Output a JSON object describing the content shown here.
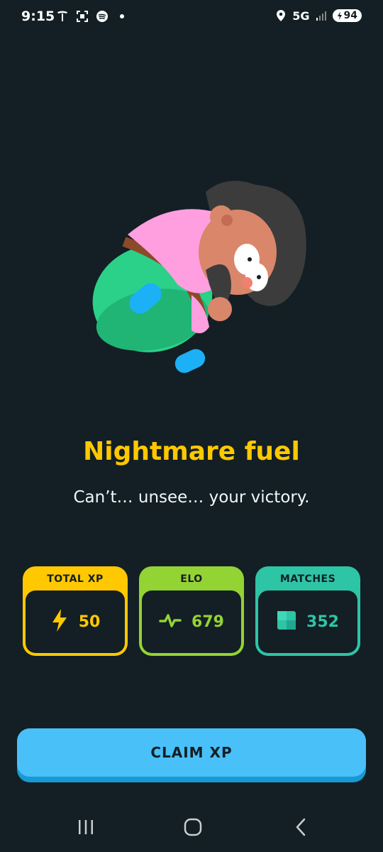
{
  "status_bar": {
    "time": "9:15",
    "network": "5G",
    "battery": "94",
    "icons": [
      "tesla-icon",
      "screenshot-icon",
      "spotify-icon",
      "dot-icon",
      "location-icon",
      "signal-icon",
      "battery-icon"
    ]
  },
  "result": {
    "title": "Nightmare fuel",
    "subtitle": "Can’t… unsee… your victory."
  },
  "stats": [
    {
      "label": "TOTAL XP",
      "value": "50",
      "icon": "lightning-icon",
      "color": "#ffc800"
    },
    {
      "label": "ELO",
      "value": "679",
      "icon": "pulse-icon",
      "color": "#93d333"
    },
    {
      "label": "MATCHES",
      "value": "352",
      "icon": "square-icon",
      "color": "#2ec4a6"
    }
  ],
  "claim_button": {
    "label": "CLAIM XP"
  },
  "colors": {
    "background": "#131f24",
    "title": "#ffc800",
    "button": "#49c0f8"
  },
  "nav": {
    "icons": [
      "recent-apps-icon",
      "home-icon",
      "back-icon"
    ]
  }
}
